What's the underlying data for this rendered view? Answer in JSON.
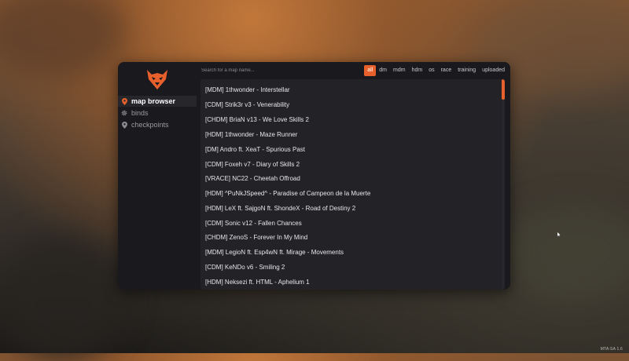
{
  "colors": {
    "accent": "#e8612c",
    "panel": "#1a1a1e",
    "list": "#222227"
  },
  "logo_icon": "fox-head-logo",
  "sidebar": {
    "items": [
      {
        "label": "map browser",
        "icon": "location-pin-icon",
        "active": true
      },
      {
        "label": "binds",
        "icon": "gear-icon",
        "active": false
      },
      {
        "label": "checkpoints",
        "icon": "location-pin-icon",
        "active": false
      }
    ]
  },
  "search": {
    "placeholder": "Search for a map name...",
    "value": ""
  },
  "filters": [
    "all",
    "dm",
    "mdm",
    "hdm",
    "os",
    "race",
    "training",
    "uploaded"
  ],
  "active_filter": "all",
  "maps": [
    "[MDM] 1thwonder - Interstellar",
    "[CDM] Strik3r v3 - Venerability",
    "[CHDM] BriaN v13 - We Love Skills 2",
    "[HDM] 1thwonder - Maze Runner",
    "[DM] Andro ft. XeaT - Spurious Past",
    "[CDM] Foxeh v7 - Diary of Skills 2",
    "[VRACE] NC22 - Cheetah Offroad",
    "[HDM] ^PuNkJSpeed^ - Paradise of Campeon de la Muerte",
    "[HDM] LeX ft. SajgoN ft. ShondeX - Road of Destiny 2",
    "[CDM] Sonic v12 - Fallen Chances",
    "[CHDM] ZenoS - Forever In My Mind",
    "[MDM] LegioN ft. Esp4wN ft. Mirage - Movements",
    "[CDM] KeNDo v6 - Smiling 2",
    "[HDM] Neksezi ft. HTML - Aphelium 1"
  ],
  "watermark": "MTA:SA 1.6"
}
